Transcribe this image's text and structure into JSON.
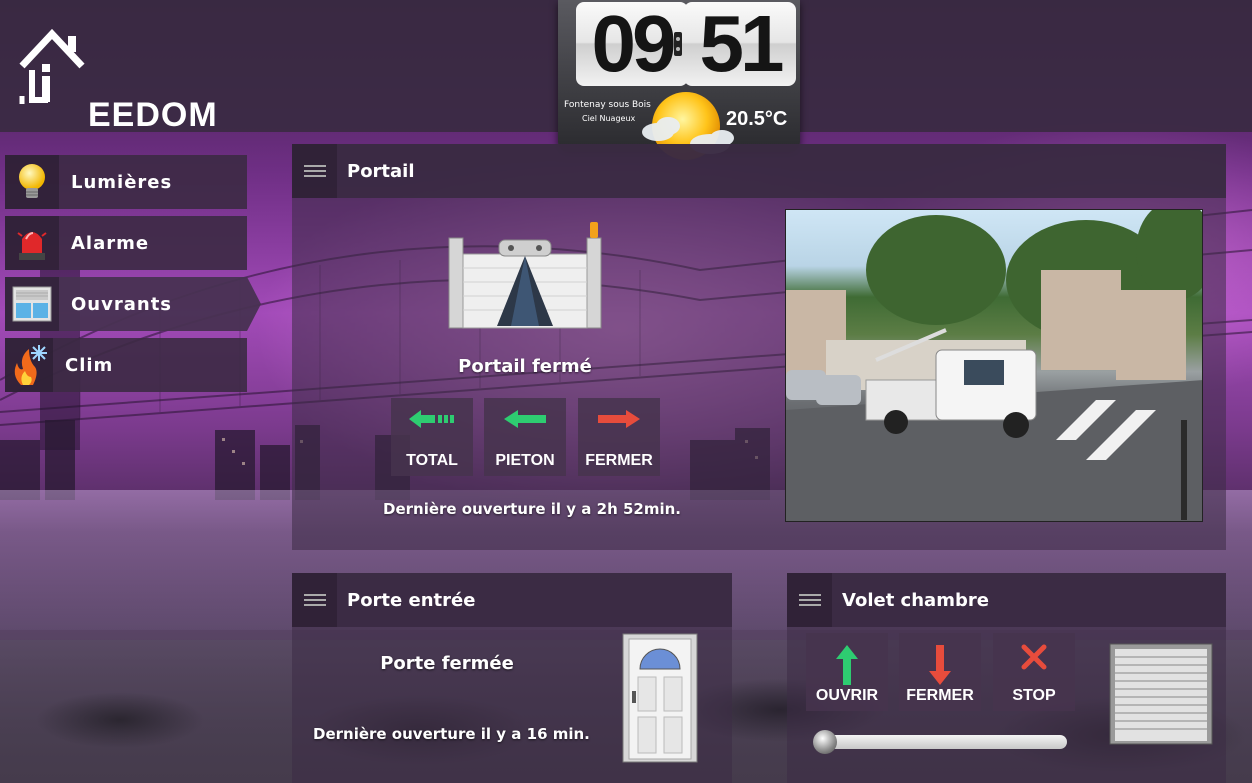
{
  "header": {
    "logo_text": "EEDOM",
    "logo_letter": "J"
  },
  "clock": {
    "hours": "09",
    "minutes": "51",
    "city": "Fontenay sous Bois",
    "condition": "Ciel Nuageux",
    "temperature": "20.5°C",
    "weather_icon": "sun-cloud-icon"
  },
  "sidebar": {
    "items": [
      {
        "label": "Lumières",
        "icon": "lightbulb-icon"
      },
      {
        "label": "Alarme",
        "icon": "siren-icon"
      },
      {
        "label": "Ouvrants",
        "icon": "window-icon",
        "active": true
      },
      {
        "label": "Clim",
        "icon": "fire-snow-icon"
      }
    ]
  },
  "portail": {
    "title": "Portail",
    "status": "Portail fermé",
    "buttons": {
      "total": "TOTAL",
      "pieton": "PIETON",
      "fermer": "FERMER"
    },
    "last_open": "Dernière ouverture il y a 2h 52min.",
    "colors": {
      "open_arrow": "#2ecc71",
      "close_arrow": "#e74c3c"
    }
  },
  "porte": {
    "title": "Porte entrée",
    "status": "Porte fermée",
    "last_open": "Dernière ouverture il y a 16 min."
  },
  "volet": {
    "title": "Volet chambre",
    "buttons": {
      "ouvrir": "OUVRIR",
      "fermer": "FERMER",
      "stop": "STOP"
    },
    "position_percent": 0
  }
}
